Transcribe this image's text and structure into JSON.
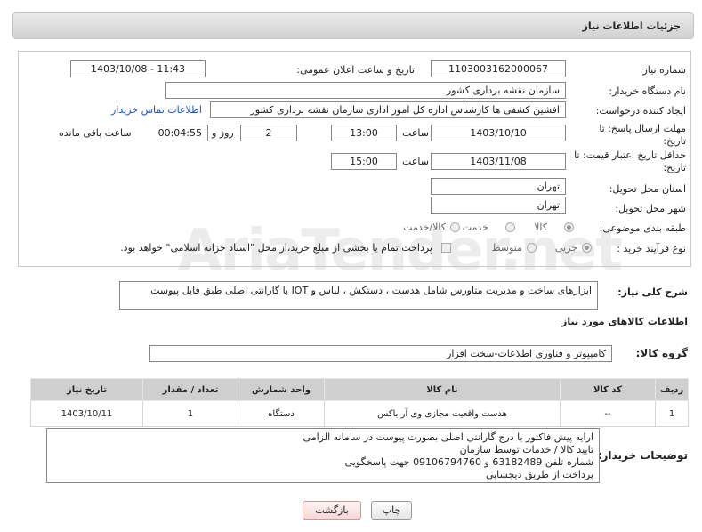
{
  "header": {
    "title": "جزئیات اطلاعات نیاز"
  },
  "fields": {
    "need_number_label": "شماره نیاز:",
    "need_number": "1103003162000067",
    "announce_label": "تاریخ و ساعت اعلان عمومی:",
    "announce_value": "1403/10/08 - 11:43",
    "buyer_org_label": "نام دستگاه خریدار:",
    "buyer_org": "سازمان نقشه برداری کشور",
    "creator_label": "ایجاد کننده درخواست:",
    "creator": "افشین کشفی ها کارشناس اداره کل امور اداری سازمان نقشه برداری کشور",
    "contact_link": "اطلاعات تماس خریدار",
    "deadline_label_1": "مهلت ارسال پاسخ: تا",
    "deadline_label_2": "تاریخ:",
    "deadline_date": "1403/10/10",
    "time_label": "ساعت",
    "deadline_time": "13:00",
    "days_value": "2",
    "days_label": "روز و",
    "remaining_time": "00:04:55",
    "remaining_label": "ساعت باقی مانده",
    "validity_label_1": "حداقل تاریخ اعتبار قیمت: تا",
    "validity_label_2": "تاریخ:",
    "validity_date": "1403/11/08",
    "validity_time": "15:00",
    "province_label": "استان محل تحویل:",
    "province": "تهران",
    "city_label": "شهر محل تحویل:",
    "city": "تهران",
    "category_label": "طبقه بندی موضوعی:",
    "category_options": [
      "کالا",
      "خدمت",
      "کالا/خدمت"
    ],
    "process_label": "نوع فرآیند خرید :",
    "process_options": [
      "جزیی",
      "متوسط"
    ],
    "payment_note": "پرداخت تمام یا بخشی از مبلغ خرید،از محل \"اسناد خزانه اسلامی\" خواهد بود."
  },
  "description": {
    "label": "شرح کلی نیاز:",
    "value": "ابزارهای ساخت و مدیریت متاورس شامل هدست ، دستکش ، لباس و IOT با گارانتی اصلی طبق فایل پیوست"
  },
  "goods_section": {
    "title": "اطلاعات کالاهای مورد نیاز",
    "group_label": "گروه کالا:",
    "group_value": "کامپیوتر و فناوری اطلاعات-سخت افزار"
  },
  "table": {
    "headers": [
      "ردیف",
      "کد کالا",
      "نام کالا",
      "واحد شمارش",
      "تعداد / مقدار",
      "تاریخ نیاز"
    ],
    "rows": [
      [
        "1",
        "--",
        "هدست واقعیت مجازی وی آر باکس",
        "دستگاه",
        "1",
        "1403/10/11"
      ]
    ]
  },
  "buyer_notes": {
    "label": "توضیحات خریدار:",
    "lines": [
      "ارایه پیش فاکتور با درج گارانتی اصلی بصورت پیوست در سامانه الزامی",
      "تایید کالا / خدمات توسط سازمان",
      "شماره تلفن 63182489 و  09106794760 جهت پاسخگویی",
      "پرداخت از طریق دیجسابی"
    ]
  },
  "buttons": {
    "print": "چاپ",
    "back": "بازگشت"
  },
  "watermark": "AriaTender.net"
}
